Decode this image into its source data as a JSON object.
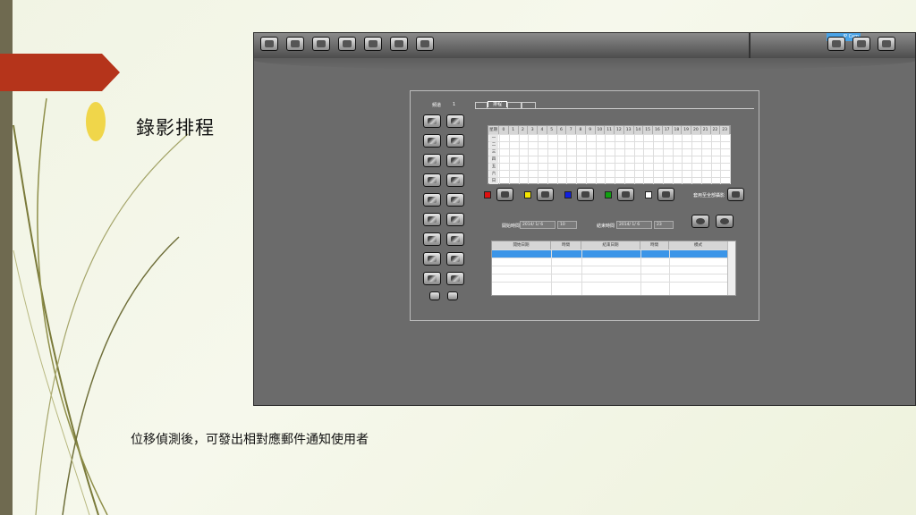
{
  "slide": {
    "title": "錄影排程",
    "caption": "位移偵測後，可發出相對應郵件通知使用者"
  },
  "colors": {
    "accent_red": "#b5341b",
    "bullet_yellow": "#f0d64a",
    "left_bar": "#6f6a50",
    "selected_row": "#3b95e8"
  },
  "app": {
    "ip_badge": "IP Cam",
    "channel_label": "頻道",
    "channel_number": "1",
    "tabs": [
      "",
      "排程",
      "",
      ""
    ],
    "schedule": {
      "corner": "星期",
      "hours": [
        "0",
        "1",
        "2",
        "3",
        "4",
        "5",
        "6",
        "7",
        "8",
        "9",
        "10",
        "11",
        "12",
        "13",
        "14",
        "15",
        "16",
        "17",
        "18",
        "19",
        "20",
        "21",
        "22",
        "23"
      ],
      "days": [
        "一",
        "二",
        "三",
        "四",
        "五",
        "六",
        "日"
      ]
    },
    "mode_colors": [
      "#e01010",
      "#f5e600",
      "#1020e0",
      "#10a010",
      "#ffffff"
    ],
    "apply_all_label": "套用至全部攝影",
    "start_label": "開始時間",
    "start_date": "2014/ 1/ 6",
    "start_hour": "10",
    "end_label": "結束時間",
    "end_date": "2014/ 1/ 6",
    "end_hour": "23",
    "table_headers": [
      "開始日期",
      "時間",
      "結束日期",
      "時間",
      "模式"
    ]
  }
}
